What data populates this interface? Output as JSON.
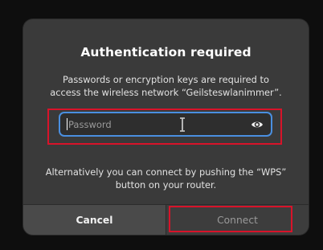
{
  "dialog": {
    "title": "Authentication required",
    "message_line1": "Passwords or encryption keys are required to",
    "message_line2": "access the wireless network “Geilsteswlanimmer”.",
    "password": {
      "placeholder": "Password",
      "value": "",
      "toggle_icon": "eye-icon"
    },
    "alt_line1": "Alternatively you can connect by pushing the “WPS”",
    "alt_line2": "button on your router.",
    "cancel_label": "Cancel",
    "connect_label": "Connect"
  },
  "colors": {
    "highlight": "#d8132a",
    "focus": "#4a8fe0",
    "dialog_bg": "#3a3a3a"
  }
}
